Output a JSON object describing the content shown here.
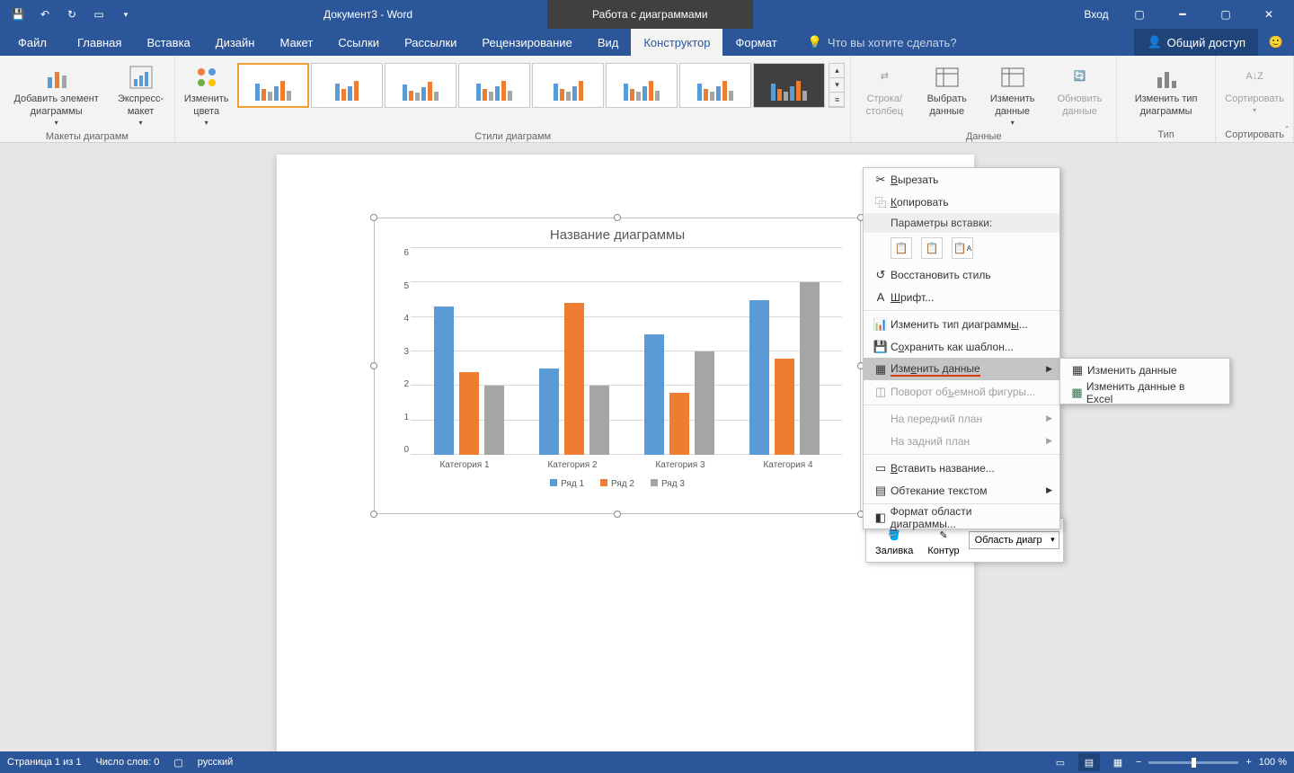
{
  "titlebar": {
    "doc_title": "Документ3 - Word",
    "chart_tools": "Работа с диаграммами",
    "signin": "Вход"
  },
  "tabs": {
    "file": "Файл",
    "home": "Главная",
    "insert": "Вставка",
    "design": "Дизайн",
    "layout": "Макет",
    "references": "Ссылки",
    "mailings": "Рассылки",
    "review": "Рецензирование",
    "view": "Вид",
    "constructor": "Конструктор",
    "format": "Формат",
    "tellme": "Что вы хотите сделать?",
    "share": "Общий доступ"
  },
  "ribbon": {
    "layouts_group": "Макеты диаграмм",
    "add_element": "Добавить элемент диаграммы",
    "express_layout": "Экспресс-макет",
    "change_colors": "Изменить цвета",
    "styles_group": "Стили диаграмм",
    "data_group": "Данные",
    "switch_rowcol": "Строка/столбец",
    "select_data": "Выбрать данные",
    "edit_data": "Изменить данные",
    "refresh_data": "Обновить данные",
    "type_group": "Тип",
    "change_type": "Изменить тип диаграммы",
    "sort_group": "Сортировать",
    "sort": "Сортировать"
  },
  "chart_data": {
    "type": "bar",
    "title": "Название диаграммы",
    "categories": [
      "Категория 1",
      "Категория 2",
      "Категория 3",
      "Категория 4"
    ],
    "series": [
      {
        "name": "Ряд 1",
        "values": [
          4.3,
          2.5,
          3.5,
          4.5
        ],
        "color": "#5b9bd5"
      },
      {
        "name": "Ряд 2",
        "values": [
          2.4,
          4.4,
          1.8,
          2.8
        ],
        "color": "#ed7d31"
      },
      {
        "name": "Ряд 3",
        "values": [
          2.0,
          2.0,
          3.0,
          5.0
        ],
        "color": "#a5a5a5"
      }
    ],
    "ylim": [
      0,
      6
    ],
    "yticks": [
      0,
      1,
      2,
      3,
      4,
      5,
      6
    ]
  },
  "context_menu": {
    "cut": "Вырезать",
    "copy": "Копировать",
    "paste_options": "Параметры вставки:",
    "restore_style": "Восстановить стиль",
    "font": "Шрифт...",
    "change_chart_type": "Изменить тип диаграммы...",
    "save_template": "Сохранить как шаблон...",
    "edit_data": "Изменить данные",
    "rotate_3d": "Поворот объемной фигуры...",
    "bring_front": "На передний план",
    "send_back": "На задний план",
    "insert_title": "Вставить название...",
    "wrap_text": "Обтекание текстом",
    "format_area": "Формат области диаграммы..."
  },
  "submenu": {
    "edit_data": "Изменить данные",
    "edit_excel": "Изменить данные в Excel"
  },
  "mini_toolbar": {
    "fill": "Заливка",
    "outline": "Контур",
    "area": "Область диагр"
  },
  "statusbar": {
    "page": "Страница 1 из 1",
    "words": "Число слов: 0",
    "lang": "русский",
    "zoom": "100 %"
  }
}
